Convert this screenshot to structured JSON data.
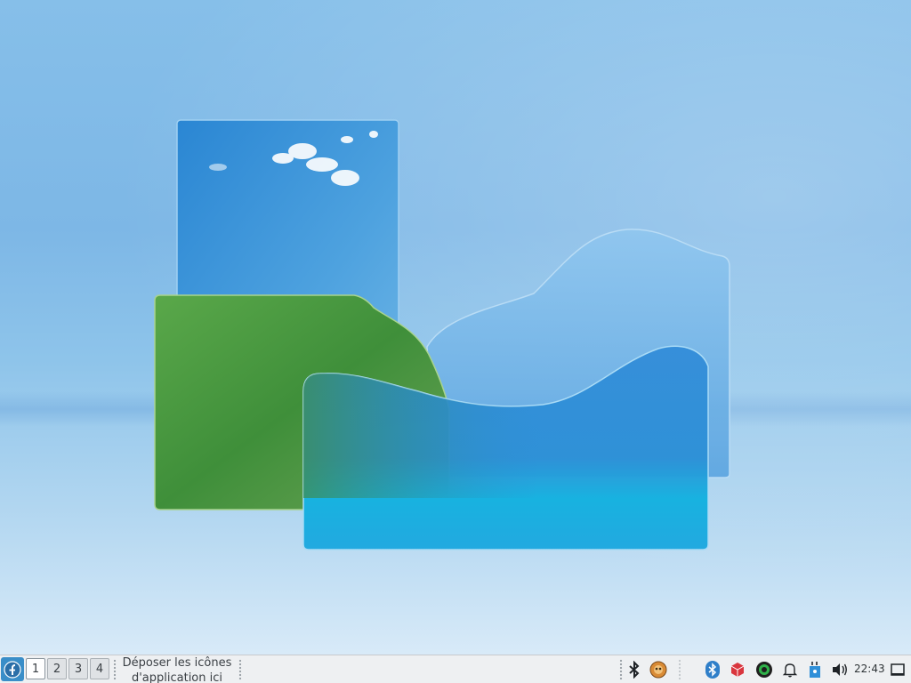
{
  "panel": {
    "menu_button": "application-menu",
    "desktops": [
      {
        "label": "1",
        "active": true
      },
      {
        "label": "2",
        "active": false
      },
      {
        "label": "3",
        "active": false
      },
      {
        "label": "4",
        "active": false
      }
    ],
    "launcher_hint": "Déposer les icônes d'application ici",
    "tray": {
      "icons": [
        "bluetooth-icon",
        "pidgin-icon",
        "bluetooth-applet-icon",
        "package-icon",
        "record-icon",
        "notifications-icon",
        "keyboard-layout-icon",
        "volume-icon"
      ],
      "clock": "22:43"
    },
    "show_desktop": "show-desktop-icon"
  },
  "colors": {
    "sky": "#7db7e6",
    "panel_bg": "#eef0f2",
    "menu_accent": "#3a8ec8",
    "glass_blue": "#2f8fd8",
    "glass_green": "#4e9a3c",
    "glass_cyan": "#19b4e2"
  }
}
